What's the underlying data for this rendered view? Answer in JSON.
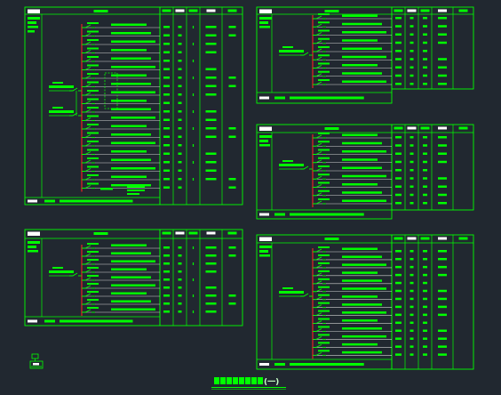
{
  "colors": {
    "background": "#212830",
    "frame": "#00ff00",
    "text_block": "#00ff00",
    "label_block": "#ffffff",
    "wire": "#d4d4d4",
    "bus": "#ff2020"
  },
  "panels": [
    {
      "circuits": 20,
      "feeders": 2
    },
    {
      "circuits": 9,
      "feeders": 1
    },
    {
      "circuits": 9,
      "feeders": 1
    },
    {
      "circuits": 9,
      "feeders": 1
    },
    {
      "circuits": 14,
      "feeders": 1
    }
  ],
  "title": {
    "suffix": "(一)"
  }
}
